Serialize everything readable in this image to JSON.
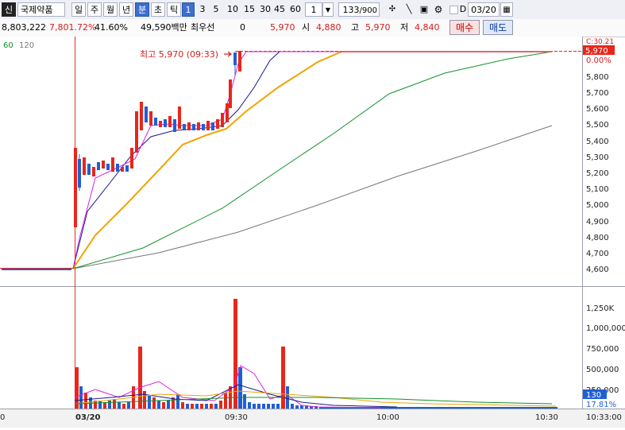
{
  "toolbar": {
    "prefix": "신",
    "stock_name": "국제약품",
    "period_day": "일",
    "period_week": "주",
    "period_month": "월",
    "period_year": "년",
    "period_minute": "분",
    "period_second": "초",
    "period_tick": "틱",
    "intervals": [
      "1",
      "3",
      "5",
      "10",
      "15",
      "30",
      "45",
      "60"
    ],
    "interval_input": "1",
    "count": "133",
    "count_max": "/900",
    "d_label": "D",
    "date": "03/20"
  },
  "info": {
    "volume": "8,803,222",
    "change_amount": "7,801.72%",
    "change_rate": "41.60%",
    "trade_value": "49,590백만",
    "priority_label": "최우선",
    "priority_value": "0",
    "current_price": "5,970",
    "open_label": "시",
    "open_value": "4,880",
    "high_label": "고",
    "high_value": "5,970",
    "low_label": "저",
    "low_value": "4,840",
    "buy_label": "매수",
    "sell_label": "매도"
  },
  "legend": {
    "ma60": "60",
    "ma120": "120"
  },
  "annotation": "최고 5,970 (09:33)",
  "price_badge": "5,970",
  "price_badge_top": "C:30.21",
  "price_pct": "0.00%",
  "price_axis": [
    "5,800",
    "5,700",
    "5,600",
    "5,500",
    "5,400",
    "5,300",
    "5,200",
    "5,100",
    "5,000",
    "4,900",
    "4,800",
    "4,700",
    "4,600"
  ],
  "volume_axis": [
    "1,250K",
    "1,000,000",
    "750,000",
    "500,000",
    "250,000"
  ],
  "volume_badge": "130",
  "volume_pct": "17.81%",
  "time_axis": [
    "0",
    "03/20",
    "09:30",
    "10:00",
    "10:30",
    "10:33:00"
  ],
  "colors": {
    "up": "#e8261b",
    "down": "#1f5fd6",
    "ma5": "#e020e0",
    "ma10": "#1a1a8c",
    "ma20": "#f0a400",
    "ma60": "#12912a",
    "ma120": "#777777",
    "sessionLine": "#e03030"
  }
}
